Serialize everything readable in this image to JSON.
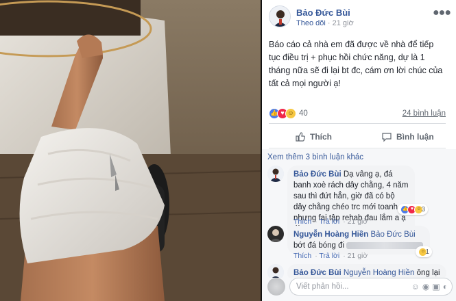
{
  "post": {
    "author": "Bảo Đức Bùi",
    "follow": "Theo dõi",
    "separator": "·",
    "time": "21 giờ",
    "text": "Báo cáo cả nhà em đã được về nhà để tiếp tục điều trị + phục hồi chức năng, dự là 1 tháng nữa sẽ đi lại bt đc, cám ơn lời chúc của tất cả mọi người ạ!",
    "reaction_count": "40",
    "comment_count": "24 bình luận",
    "actions": {
      "like": "Thích",
      "comment": "Bình luận"
    }
  },
  "comments": {
    "view_more": "Xem thêm 3 bình luận khác",
    "items": [
      {
        "name": "Bảo Đức Bùi",
        "text": "Dạ vâng ạ, đá banh xoè rách dây chằng, 4 năm sau thì đứt hẳn, giờ đã có bộ dây chằng chéo trc mới toanh nhưng fai tập rehab đau lắm a ạ :))",
        "like": "Thích",
        "dot": "·",
        "reply": "Trả lời",
        "time": "21 giờ",
        "reaction_count": "3"
      },
      {
        "name": "Nguyễn Hoàng Hiền",
        "tag": "Bảo Đức Bùi",
        "text_a": "bớt đá",
        "text_b": "bóng đi",
        "like": "Thích",
        "dot": "·",
        "reply": "Trả lời",
        "time": "21 giờ",
        "reaction_count": "1"
      },
      {
        "name": "Bảo Đức Bùi",
        "tag": "Nguyễn Hoàng Hiền",
        "text": "ông lại"
      }
    ],
    "reply_placeholder": "Viết phản hồi..."
  },
  "colors": {
    "link": "#365899",
    "like_blue": "#4b7bea",
    "love_red": "#f0284a",
    "haha_yellow": "#f7c844"
  }
}
